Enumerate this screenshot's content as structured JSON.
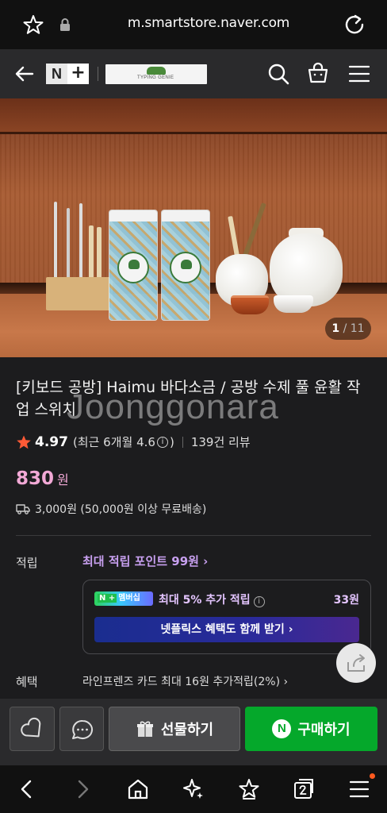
{
  "browser": {
    "url": "m.smartstore.naver.com"
  },
  "header": {
    "brand_badge_n": "N",
    "brand_badge_plus": "+",
    "store_logo_text": "TYPING GENIE"
  },
  "hero": {
    "page_current": "1",
    "page_total": "/ 11"
  },
  "product": {
    "title": "[키보드 공방] Haimu 바다소금 / 공방 수제 풀 윤활 작업 스위치",
    "watermark": "Joonggonara",
    "rating": "4.97",
    "rating_detail": "(최근 6개월 4.6",
    "rating_info": "i",
    "rating_detail_close": ")",
    "reviews": "139건 리뷰",
    "price": "830",
    "price_unit": "원",
    "shipping": "3,000원 (50,000원 이상 무료배송)"
  },
  "points": {
    "label": "적립",
    "link": "최대 적립 포인트 99원 ›",
    "membership_n": "N +",
    "membership_label": "멤버십",
    "max_rate": "최대 5% 추가 적립",
    "info": "i",
    "amount": "33원",
    "netflix_button": "넷플릭스 혜택도 함께 받기 ›"
  },
  "benefit": {
    "label": "혜택",
    "text": "라인프렌즈 카드 최대 16원 추가적립(2%) ›"
  },
  "actions": {
    "gift": "선물하기",
    "buy_n": "N",
    "buy": "구매하기"
  },
  "colors": {
    "price": "#f2a9d6",
    "buy": "#05a82b",
    "points": "#c8a0f0"
  }
}
